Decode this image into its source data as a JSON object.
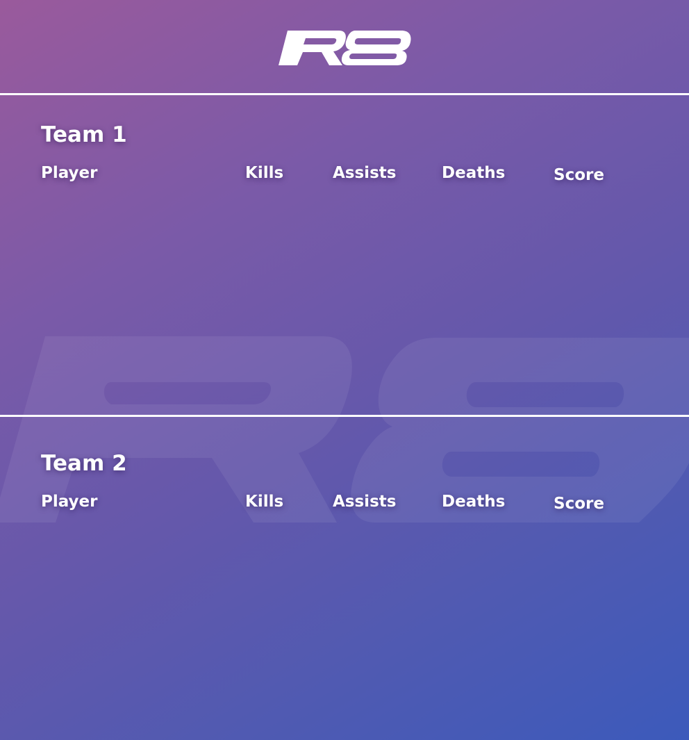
{
  "app": {
    "logo_text": "R8",
    "watermark_text": "R8",
    "colors": {
      "gradient_start": "#9a5a9c",
      "gradient_end": "#3c5abb",
      "text": "#ffffff",
      "divider": "#ffffff"
    }
  },
  "teams": [
    {
      "title": "Team 1",
      "columns": {
        "player": "Player",
        "kills": "Kills",
        "assists": "Assists",
        "deaths": "Deaths",
        "score": "Score"
      },
      "rows": []
    },
    {
      "title": "Team 2",
      "columns": {
        "player": "Player",
        "kills": "Kills",
        "assists": "Assists",
        "deaths": "Deaths",
        "score": "Score"
      },
      "rows": []
    }
  ]
}
